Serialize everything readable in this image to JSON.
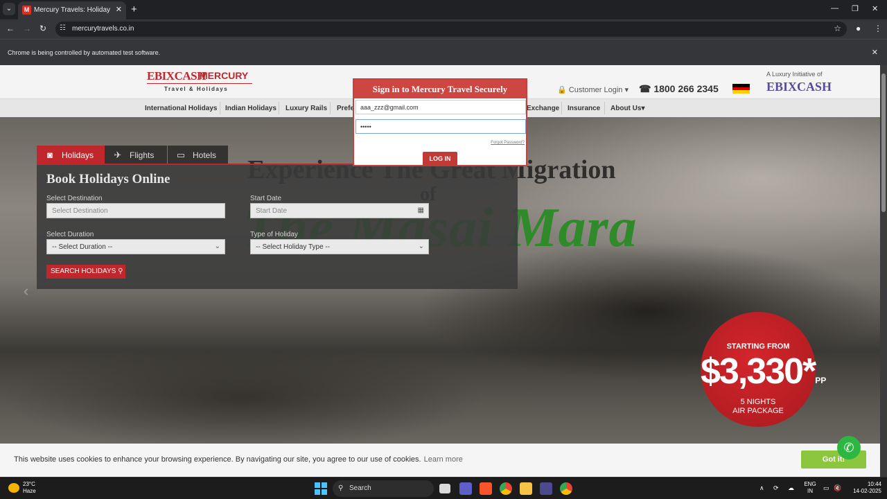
{
  "browser": {
    "tab_title": "Mercury Travels: Holiday Packages",
    "tab_favicon": "M",
    "url": "mercurytravels.co.in",
    "infobar": "Chrome is being controlled by automated test software."
  },
  "site": {
    "logo_ebix": "EBIXCASH",
    "logo_mercury": "MERCURY",
    "logo_tagline": "Travel & Holidays",
    "customer_login": "Customer Login",
    "phone": "1800 266 2345",
    "luxury_text": "A Luxury Initiative of",
    "luxury_logo": "EBIXCASH",
    "menu": [
      "International Holidays",
      "Indian Holidays",
      "Luxury Rails",
      "Prefe",
      "Exchange",
      "Insurance",
      "About Us"
    ]
  },
  "hero": {
    "line1": "Experience The Great Migration",
    "line2": "of",
    "line3": "The Masai Mara",
    "badge_top": "STARTING FROM",
    "badge_price": "$3,330*",
    "badge_pp": "PP",
    "badge_bottom1": "5 NIGHTS",
    "badge_bottom2": "AIR PACKAGE"
  },
  "booking": {
    "tabs": [
      "Holidays",
      "Flights",
      "Hotels"
    ],
    "title": "Book Holidays Online",
    "destination_label": "Select Destination",
    "destination_placeholder": "Select Destination",
    "start_label": "Start Date",
    "start_placeholder": "Start Date",
    "duration_label": "Select Duration",
    "duration_value": "-- Select Duration --",
    "type_label": "Type of Holiday",
    "type_value": "-- Select Holiday Type --",
    "search_button": "SEARCH HOLIDAYS"
  },
  "login": {
    "title": "Sign in to Mercury Travel Securely",
    "email": "aaa_zzz@gmail.com",
    "password": "•••••",
    "forgot": "Forgot Password?",
    "button": "LOG IN"
  },
  "cookie": {
    "text": "This website uses cookies to enhance your browsing experience. By navigating our site, you agree to our use of cookies.",
    "link": "Learn more",
    "button": "Got it!"
  },
  "taskbar": {
    "temp": "23°C",
    "weather": "Haze",
    "search": "Search",
    "lang1": "ENG",
    "lang2": "IN",
    "time": "10:44",
    "date": "14-02-2025"
  },
  "colors": {
    "brand_red": "#c0272d",
    "cookie_green": "#8cc63f",
    "whatsapp": "#2db742"
  }
}
